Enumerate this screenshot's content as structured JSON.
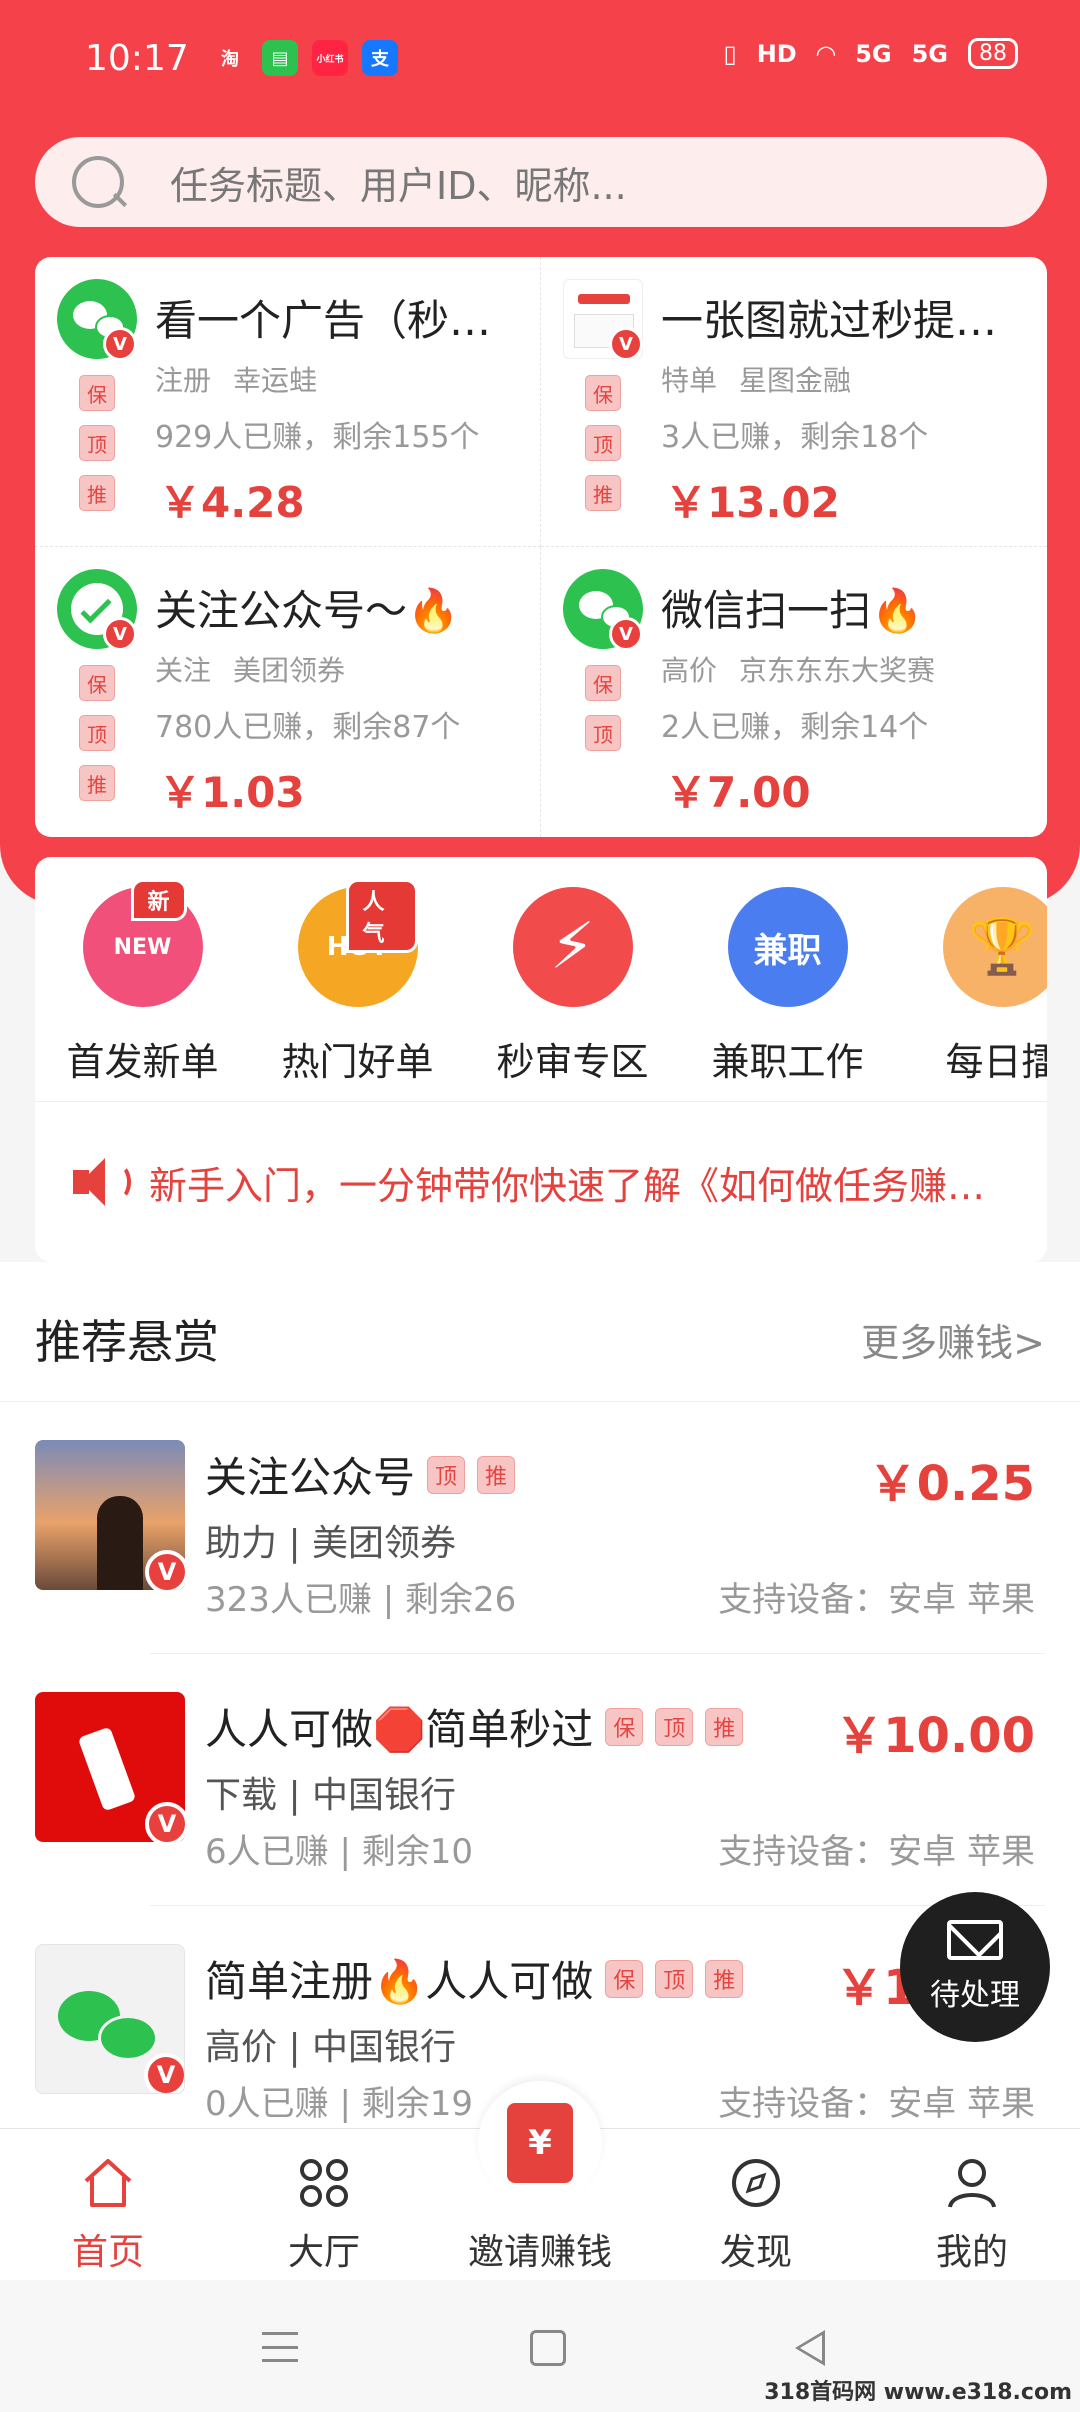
{
  "status_bar": {
    "time": "10:17",
    "apps": [
      "淘",
      "▤",
      "小红书",
      "支"
    ],
    "indicators": [
      "HD",
      "5G",
      "5G"
    ],
    "battery": "88"
  },
  "search": {
    "placeholder": "任务标题、用户ID、昵称..."
  },
  "featured_tasks": [
    {
      "title": "看一个广告（秒下…",
      "category": "注册",
      "merchant": "幸运蛙",
      "stats": "929人已赚，剩余155个",
      "price": "￥4.28",
      "tags": [
        "保",
        "顶",
        "推"
      ]
    },
    {
      "title": "一张图就过秒提…",
      "category": "特单",
      "merchant": "星图金融",
      "stats": "3人已赚，剩余18个",
      "price": "￥13.02",
      "tags": [
        "保",
        "顶",
        "推"
      ]
    },
    {
      "title": "关注公众号～🔥",
      "category": "关注",
      "merchant": "美团领券",
      "stats": "780人已赚，剩余87个",
      "price": "￥1.03",
      "tags": [
        "保",
        "顶",
        "推"
      ]
    },
    {
      "title": "微信扫一扫🔥",
      "category": "高价",
      "merchant": "京东东东大奖赛",
      "stats": "2人已赚，剩余14个",
      "price": "￥7.00",
      "tags": [
        "保",
        "顶"
      ]
    }
  ],
  "quick_entries": [
    {
      "label": "首发新单",
      "badge": "新",
      "icon_text": "NEW",
      "color": "#f0507a"
    },
    {
      "label": "热门好单",
      "badge": "人气",
      "icon_text": "HOT",
      "color": "#f5a623"
    },
    {
      "label": "秒审专区",
      "badge": "",
      "icon_text": "⚡",
      "color": "#f14b4b"
    },
    {
      "label": "兼职工作",
      "badge": "",
      "icon_text": "兼职",
      "color": "#4a7ef0"
    },
    {
      "label": "每日擂",
      "badge": "",
      "icon_text": "🏆",
      "color": "#f7b267"
    }
  ],
  "notice": {
    "text": "新手入门，一分钟带你快速了解《如何做任务赚钱》"
  },
  "recommend": {
    "title": "推荐悬赏",
    "more": "更多赚钱>",
    "items": [
      {
        "title": "关注公众号",
        "tags": [
          "顶",
          "推"
        ],
        "desc": "助力 | 美团领券",
        "stats": "323人已赚 |  剩余26",
        "devices": "支持设备：安卓 苹果",
        "price": "￥0.25"
      },
      {
        "title": "人人可做🛑简单秒过",
        "tags": [
          "保",
          "顶",
          "推"
        ],
        "desc": "下载 | 中国银行",
        "stats": "6人已赚 |  剩余10",
        "devices": "支持设备：安卓 苹果",
        "price": "￥10.00"
      },
      {
        "title": "简单注册🔥人人可做",
        "tags": [
          "保",
          "顶",
          "推"
        ],
        "desc": "高价 | 中国银行",
        "stats": "0人已赚 |  剩余19",
        "devices": "支持设备：安卓 苹果",
        "price": "￥10.88"
      }
    ]
  },
  "float_button": {
    "label": "待处理"
  },
  "tabbar": [
    {
      "label": "首页",
      "icon": "home-icon",
      "active": true
    },
    {
      "label": "大厅",
      "icon": "grid-icon",
      "active": false
    },
    {
      "label": "邀请赚钱",
      "icon": "red-packet-icon",
      "active": false
    },
    {
      "label": "发现",
      "icon": "compass-icon",
      "active": false
    },
    {
      "label": "我的",
      "icon": "user-icon",
      "active": false
    }
  ],
  "watermark": "318首码网 www.e318.com",
  "colors": {
    "brand_red": "#f5414a",
    "price_red": "#e5413d"
  }
}
